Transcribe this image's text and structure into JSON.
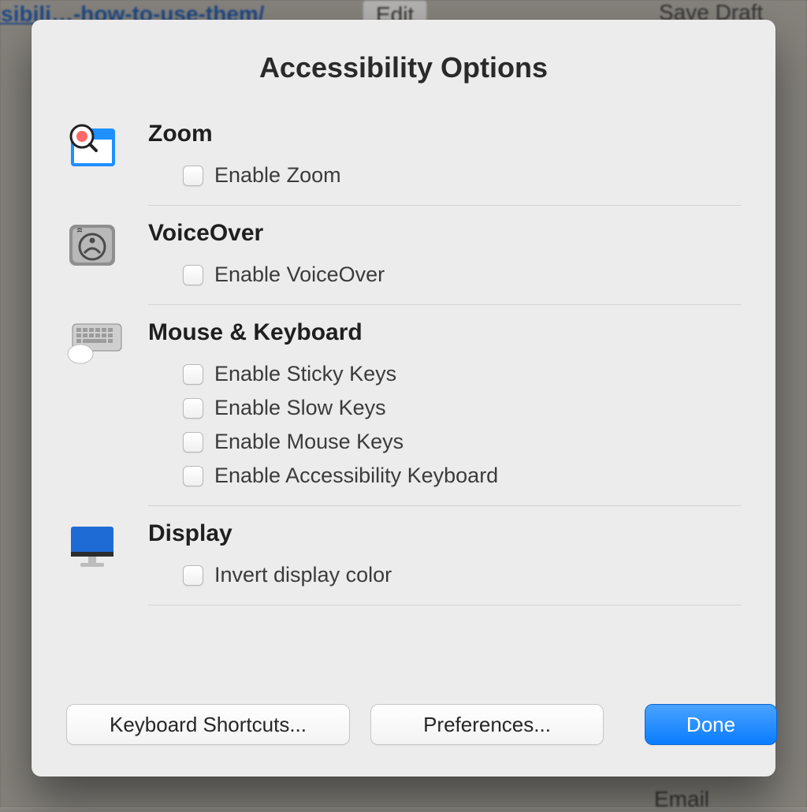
{
  "dialog": {
    "title": "Accessibility Options",
    "sections": [
      {
        "heading": "Zoom",
        "icon": "zoom-icon",
        "options": [
          {
            "label": "Enable Zoom",
            "checked": false
          }
        ]
      },
      {
        "heading": "VoiceOver",
        "icon": "voiceover-icon",
        "options": [
          {
            "label": "Enable VoiceOver",
            "checked": false
          }
        ]
      },
      {
        "heading": "Mouse & Keyboard",
        "icon": "mouse-keyboard-icon",
        "options": [
          {
            "label": "Enable Sticky Keys",
            "checked": false
          },
          {
            "label": "Enable Slow Keys",
            "checked": false
          },
          {
            "label": "Enable Mouse Keys",
            "checked": false
          },
          {
            "label": "Enable Accessibility Keyboard",
            "checked": false
          }
        ]
      },
      {
        "heading": "Display",
        "icon": "display-icon",
        "options": [
          {
            "label": "Invert display color",
            "checked": false
          }
        ]
      }
    ],
    "buttons": {
      "keyboard_shortcuts": "Keyboard Shortcuts...",
      "preferences": "Preferences...",
      "done": "Done"
    }
  },
  "background": {
    "top_url_fragment": "essibili…-how-to-use-them/",
    "top_button_edit": "Edit",
    "top_button_save_draft": "Save Draft",
    "bottom_email": "Email"
  }
}
